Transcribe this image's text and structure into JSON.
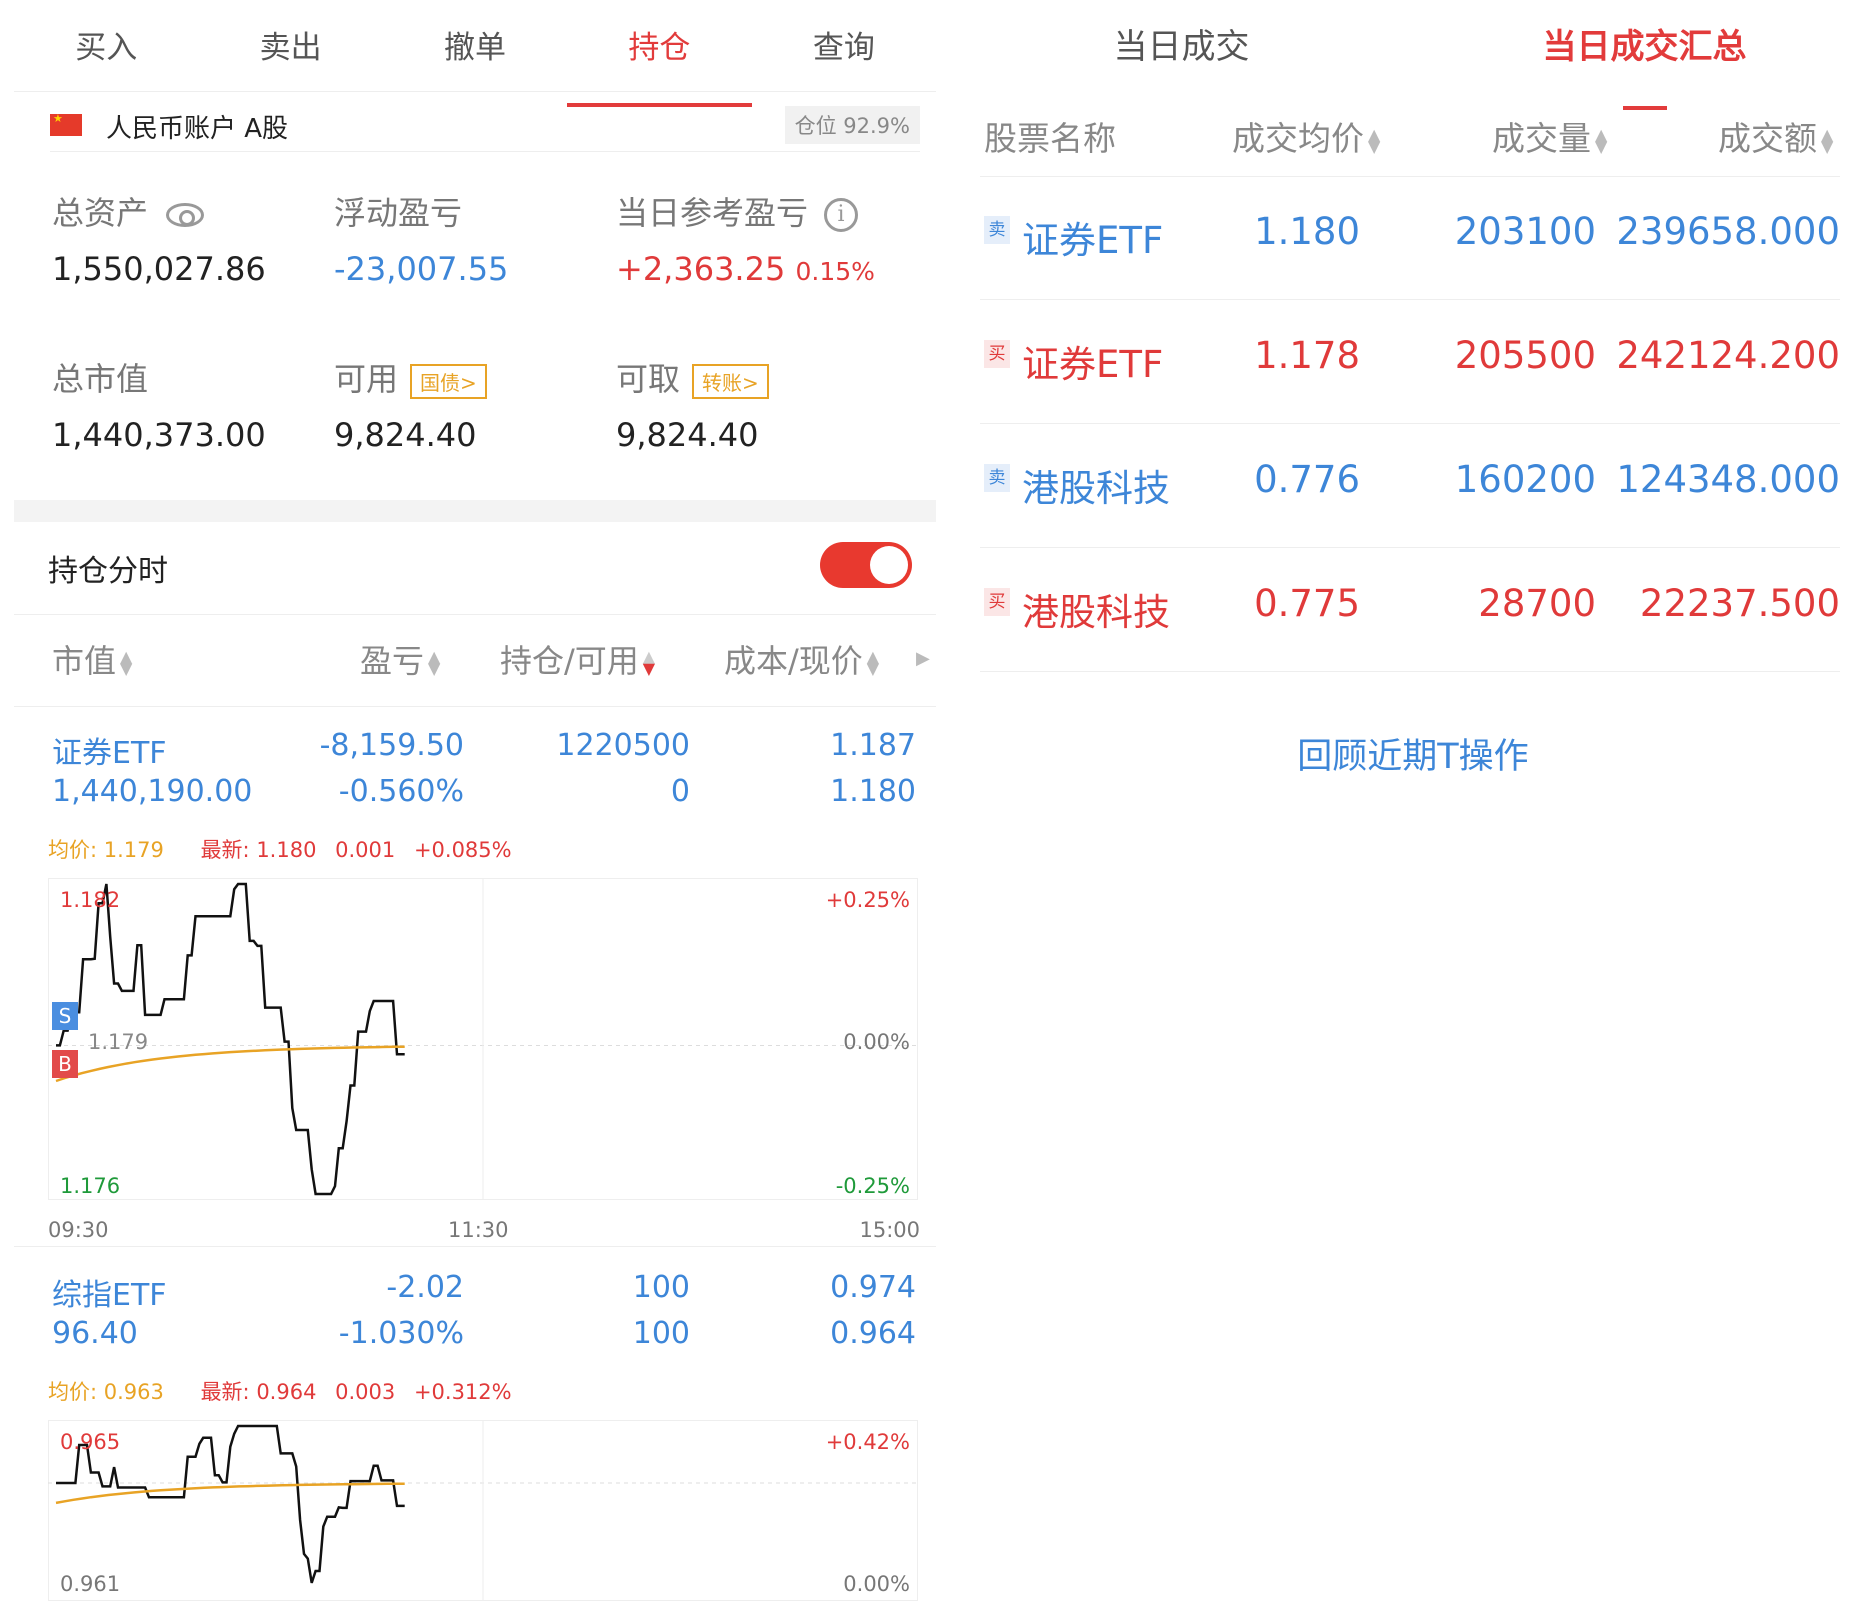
{
  "left": {
    "tabs": [
      "买入",
      "卖出",
      "撤单",
      "持仓",
      "查询"
    ],
    "account": {
      "name": "人民币账户 A股",
      "position_ratio": "仓位 92.9%"
    },
    "summary": {
      "total_assets_label": "总资产",
      "total_assets": "1,550,027.86",
      "float_pl_label": "浮动盈亏",
      "float_pl": "-23,007.55",
      "day_pl_label": "当日参考盈亏",
      "day_pl": "+2,363.25",
      "day_pl_pct": "0.15%",
      "market_value_label": "总市值",
      "market_value": "1,440,373.00",
      "available_label": "可用",
      "available_tag": "国债>",
      "available": "9,824.40",
      "withdrawable_label": "可取",
      "withdrawable_tag": "转账>",
      "withdrawable": "9,824.40"
    },
    "section_title": "持仓分时",
    "toggle_on": true,
    "columns": [
      "市值",
      "盈亏",
      "持仓/可用",
      "成本/现价"
    ],
    "holdings": [
      {
        "name": "证券ETF",
        "market_value": "1,440,190.00",
        "pl": "-8,159.50",
        "pl_pct": "-0.560%",
        "position": "1220500",
        "available": "0",
        "cost": "1.187",
        "price": "1.180",
        "avg": "均价: 1.179",
        "latest": "最新: 1.180",
        "change": "0.001",
        "change_pct": "+0.085%",
        "chart": {
          "y_high": "1.182",
          "y_mid": "1.179",
          "y_low": "1.176",
          "pct_high": "+0.25%",
          "pct_mid": "0.00%",
          "pct_low": "-0.25%",
          "times": [
            "09:30",
            "11:30",
            "15:00"
          ],
          "marker_s": "S",
          "marker_b": "B"
        }
      },
      {
        "name": "综指ETF",
        "market_value": "96.40",
        "pl": "-2.02",
        "pl_pct": "-1.030%",
        "position": "100",
        "available": "100",
        "cost": "0.974",
        "price": "0.964",
        "avg": "均价: 0.963",
        "latest": "最新: 0.964",
        "change": "0.003",
        "change_pct": "+0.312%",
        "chart": {
          "y_high": "0.965",
          "y_low": "0.961",
          "pct_high": "+0.42%",
          "pct_low": "0.00%"
        }
      }
    ]
  },
  "right": {
    "tabs": [
      "当日成交",
      "当日成交汇总"
    ],
    "columns": [
      "股票名称",
      "成交均价",
      "成交量",
      "成交额"
    ],
    "rows": [
      {
        "side": "卖",
        "name": "证券ETF",
        "avg_price": "1.180",
        "volume": "203100",
        "amount": "239658.000",
        "color": "#3d86d8"
      },
      {
        "side": "买",
        "name": "证券ETF",
        "avg_price": "1.178",
        "volume": "205500",
        "amount": "242124.200",
        "color": "#e03a3a"
      },
      {
        "side": "卖",
        "name": "港股科技",
        "avg_price": "0.776",
        "volume": "160200",
        "amount": "124348.000",
        "color": "#3d86d8"
      },
      {
        "side": "买",
        "name": "港股科技",
        "avg_price": "0.775",
        "volume": "28700",
        "amount": "22237.500",
        "color": "#e03a3a"
      }
    ],
    "review_link": "回顾近期T操作"
  }
}
